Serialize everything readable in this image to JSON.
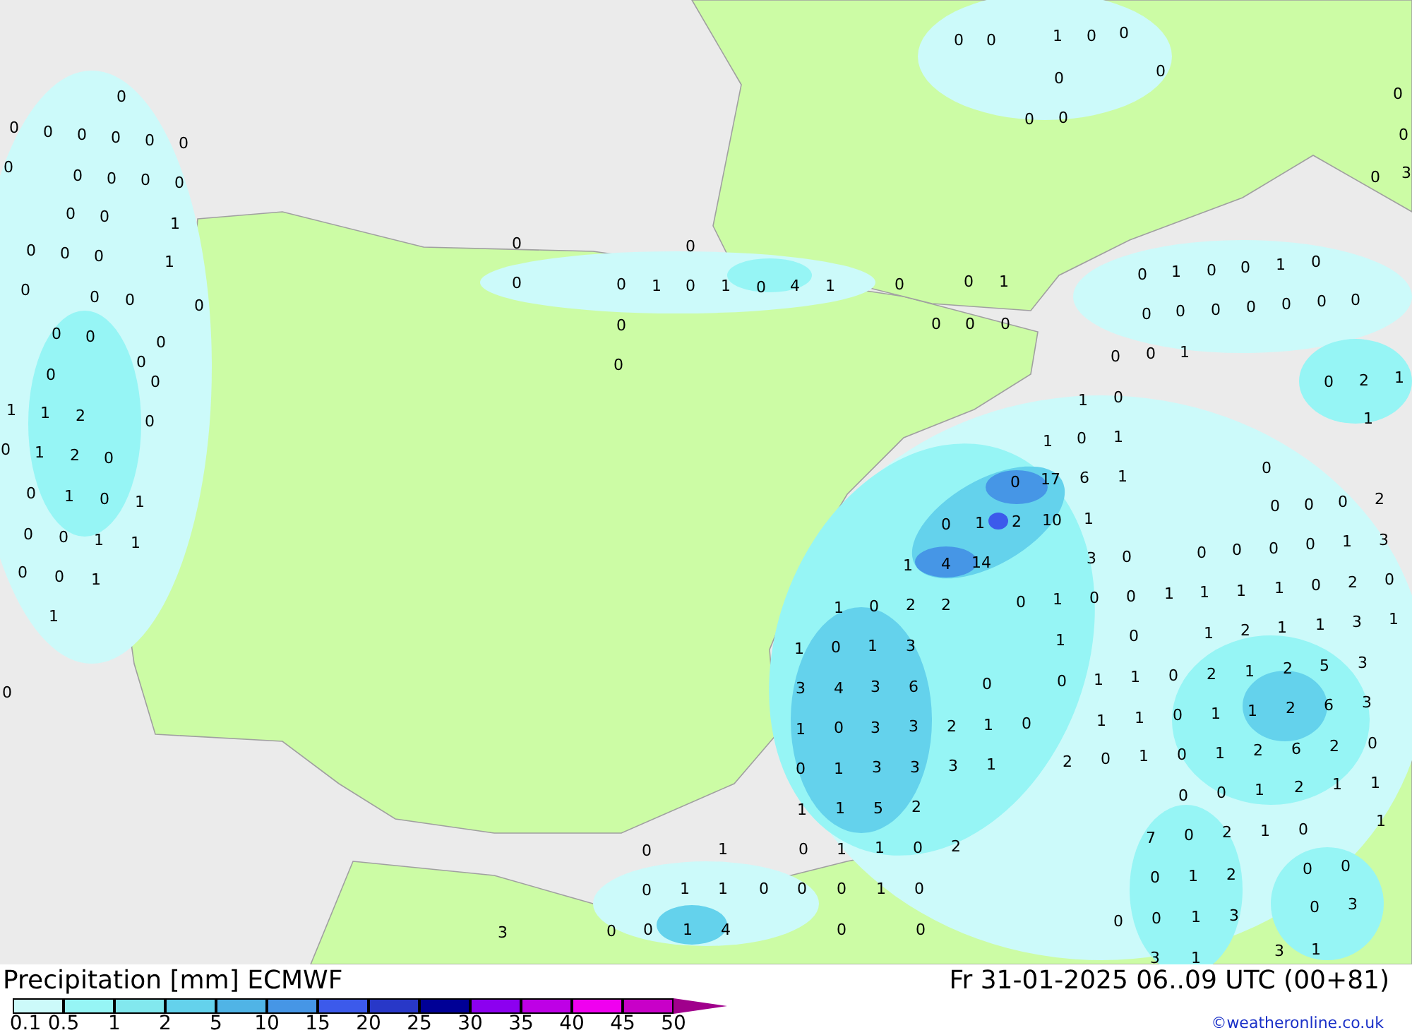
{
  "map": {
    "values": [
      "0",
      "0",
      "1",
      "0",
      "0",
      "0",
      "0",
      "0",
      "0",
      "0",
      "0",
      "0",
      "3",
      "0",
      "0",
      "0",
      "0",
      "0",
      "0",
      "0",
      "0",
      "0",
      "0",
      "0",
      "0",
      "0",
      "0",
      "1",
      "0",
      "0",
      "0",
      "1",
      "0",
      "0",
      "0",
      "0",
      "0",
      "0",
      "0",
      "0",
      "0",
      "0",
      "1",
      "1",
      "2",
      "0",
      "0",
      "1",
      "2",
      "0",
      "0",
      "1",
      "0",
      "1",
      "0",
      "0",
      "1",
      "1",
      "0",
      "0",
      "1",
      "1",
      "0",
      "0",
      "0",
      "0",
      "0",
      "1",
      "0",
      "1",
      "0",
      "4",
      "1",
      "0",
      "0",
      "1",
      "0",
      "0",
      "0",
      "0",
      "0",
      "0",
      "1",
      "0",
      "0",
      "1",
      "0",
      "0",
      "0",
      "0",
      "0",
      "0",
      "0",
      "0",
      "0",
      "0",
      "1",
      "0",
      "2",
      "1",
      "1",
      "1",
      "0",
      "1",
      "0",
      "1",
      "0",
      "0",
      "17",
      "6",
      "1",
      "0",
      "1",
      "2",
      "10",
      "1",
      "0",
      "0",
      "0",
      "2",
      "1",
      "4",
      "14",
      "3",
      "0",
      "0",
      "0",
      "0",
      "0",
      "1",
      "3",
      "1",
      "0",
      "2",
      "2",
      "0",
      "1",
      "0",
      "0",
      "1",
      "1",
      "1",
      "1",
      "0",
      "2",
      "0",
      "1",
      "0",
      "1",
      "3",
      "1",
      "0",
      "1",
      "2",
      "1",
      "1",
      "3",
      "1",
      "3",
      "4",
      "3",
      "6",
      "0",
      "0",
      "1",
      "1",
      "0",
      "2",
      "1",
      "2",
      "5",
      "3",
      "1",
      "0",
      "3",
      "3",
      "2",
      "1",
      "0",
      "1",
      "1",
      "0",
      "1",
      "1",
      "2",
      "6",
      "3",
      "0",
      "1",
      "3",
      "3",
      "3",
      "1",
      "2",
      "0",
      "1",
      "0",
      "1",
      "2",
      "6",
      "2",
      "0",
      "1",
      "1",
      "5",
      "2",
      "0",
      "0",
      "1",
      "2",
      "1",
      "1",
      "1",
      "0",
      "1",
      "0",
      "1",
      "1",
      "0",
      "2",
      "7",
      "0",
      "2",
      "1",
      "0",
      "0",
      "1",
      "1",
      "0",
      "0",
      "0",
      "1",
      "0",
      "0",
      "1",
      "2",
      "0",
      "0",
      "0",
      "0",
      "1",
      "4",
      "0",
      "0",
      "0",
      "0",
      "1",
      "3",
      "0",
      "3",
      "3",
      "1",
      "3",
      "1",
      "3"
    ]
  },
  "title": {
    "label": "Precipitation [mm] ECMWF",
    "datetime": "Fr 31-01-2025 06..09 UTC (00+81)"
  },
  "legend": {
    "bins": [
      {
        "color": "#ccfafa"
      },
      {
        "color": "#96f5f5"
      },
      {
        "color": "#82e8ee"
      },
      {
        "color": "#64d2ec"
      },
      {
        "color": "#50b4e6"
      },
      {
        "color": "#4696e6"
      },
      {
        "color": "#3c5aeb"
      },
      {
        "color": "#2838c8"
      },
      {
        "color": "#000096"
      },
      {
        "color": "#8c00f0"
      },
      {
        "color": "#be00e6"
      },
      {
        "color": "#f000f0"
      },
      {
        "color": "#c800c8"
      }
    ],
    "ticks": [
      "0.1",
      "0.5",
      "1",
      "2",
      "5",
      "10",
      "15",
      "20",
      "25",
      "30",
      "35",
      "40",
      "45",
      "50"
    ]
  },
  "credit": "©weatheronline.co.uk"
}
